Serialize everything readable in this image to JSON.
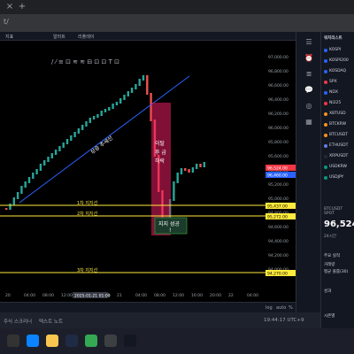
{
  "browser": {
    "url_fragment": "t/",
    "new_tab": "+"
  },
  "toolbar": {
    "items": [
      "지표",
      "알러트",
      "리플레이"
    ]
  },
  "chart": {
    "trend_label": "상승 추세선",
    "drop_label": "이탈 후 급 하락",
    "support_success_label": "지지 성공",
    "support_success_mark": "!",
    "support1_label": "1차 지지선",
    "support2_label": "2차 지지선",
    "support3_label": "3차 지지선",
    "price_ticks": [
      "97,000.00",
      "96,800.00",
      "96,600.00",
      "96,400.00",
      "96,200.00",
      "96,000.00",
      "95,800.00",
      "95,600.00",
      "95,400.00",
      "95,200.00",
      "95,000.00",
      "94,800.00",
      "94,600.00",
      "94,400.00",
      "94,200.00",
      "94,000.00"
    ],
    "price_tags": {
      "current": "96,524.00",
      "current_bg": "#f23645",
      "blue": "96,460.00",
      "support1": "95,437.00",
      "support2": "95,272.00",
      "support3": "94,270.00"
    },
    "time_ticks": [
      "20",
      "04:00",
      "08:00",
      "12:00",
      "16:00",
      "20:00",
      "21",
      "04:00",
      "08:00",
      "12:00",
      "16:00",
      "20:00",
      "22",
      "04:00"
    ],
    "time_cursor": "2025-01-21 01:00",
    "colors": {
      "support": "#ffeb3b",
      "trend": "#2962ff",
      "drop_box": "#e91e63",
      "up": "#26a69a",
      "down": "#ef5350"
    }
  },
  "chart_bottom": {
    "range": "1D",
    "log": "log",
    "auto": "auto",
    "percent": "%"
  },
  "watchlist": {
    "title": "워치리스트",
    "items": [
      {
        "label": "KOSPI",
        "color": "#2962ff"
      },
      {
        "label": "KOSPI200",
        "color": "#2962ff"
      },
      {
        "label": "KOSDAQ",
        "color": "#2962ff"
      },
      {
        "label": "SPX",
        "color": "#f23645"
      },
      {
        "label": "NDX",
        "color": "#2962ff"
      },
      {
        "label": "NI225",
        "color": "#f23645"
      },
      {
        "label": "XBTUSD",
        "color": "#f7931a"
      },
      {
        "label": "BTCKRW",
        "color": "#f7931a"
      },
      {
        "label": "BTCUSDT",
        "color": "#f7931a"
      },
      {
        "label": "ETHUSDT",
        "color": "#627eea"
      },
      {
        "label": "XRPUSDT",
        "color": "#23292f"
      },
      {
        "label": "USDKRW",
        "color": "#089981"
      },
      {
        "label": "USDJPY",
        "color": "#089981"
      }
    ],
    "symbol": "BTCUSDT SPOT",
    "big_price": "96,524.",
    "change": "24시간",
    "sub_labels": [
      "주요 실적",
      "거래량",
      "평균 볼륨(30)",
      "성과",
      "시즌별"
    ]
  },
  "status_bar": {
    "items": [
      "주식 스크리너",
      "텍스트 노트",
      "파인 에디터",
      "전략 테스터",
      "트레이딩 패널"
    ],
    "time": "19:44:17 UTC+9",
    "tf": [
      "1D",
      "5D",
      "1M",
      "3M",
      "6M",
      "YTD",
      "1Y",
      "5Y",
      "전체"
    ]
  },
  "taskbar": {
    "apps": [
      "search",
      "edge",
      "explorer",
      "chrome",
      "store",
      "mail",
      "tradingview"
    ]
  }
}
